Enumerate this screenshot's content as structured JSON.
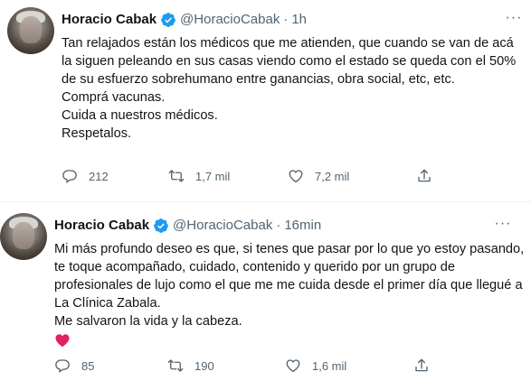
{
  "tweets": [
    {
      "name": "Horacio Cabak",
      "handle": "@HoracioCabak",
      "dot": "·",
      "time": "1h",
      "more": "···",
      "paragraph1": "Tan relajados están los médicos que me atienden, que cuando se van de acá la siguen peleando en sus casas viendo como el estado se queda con el 50% de su esfuerzo sobrehumano entre ganancias, obra social, etc, etc.",
      "line1": "Comprá vacunas.",
      "line2": "Cuida a nuestros médicos.",
      "line3": "Respetalos.",
      "replies": "212",
      "retweets": "1,7 mil",
      "likes": "7,2 mil"
    },
    {
      "name": "Horacio Cabak",
      "handle": "@HoracioCabak",
      "dot": "·",
      "time": "16min",
      "more": "···",
      "paragraph1": "Mi más profundo deseo es que, si tenes que pasar por lo que yo estoy pasando, te toque acompañado, cuidado, contenido y querido por un grupo de profesionales de lujo como el que me me cuida desde el primer día que llegué a La Clínica Zabala.",
      "line1": "Me salvaron la vida y la cabeza.",
      "replies": "85",
      "retweets": "190",
      "likes": "1,6 mil"
    }
  ],
  "colors": {
    "verified": "#1d9bf0",
    "text": "#0f1419",
    "muted": "#536471",
    "heart": "#e0245e"
  },
  "icons": [
    "verified-badge-icon",
    "more-options-icon",
    "reply-icon",
    "retweet-icon",
    "like-icon",
    "share-icon",
    "red-heart-emoji"
  ]
}
